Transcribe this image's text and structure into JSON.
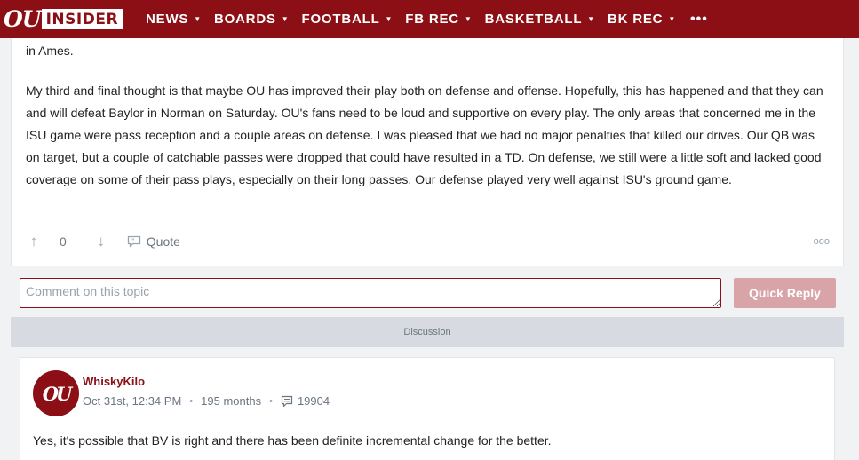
{
  "header": {
    "logo_ou": "OU",
    "logo_insider": "INSIDER",
    "nav": [
      {
        "label": "NEWS"
      },
      {
        "label": "BOARDS"
      },
      {
        "label": "FOOTBALL"
      },
      {
        "label": "FB REC"
      },
      {
        "label": "BASKETBALL"
      },
      {
        "label": "BK REC"
      }
    ],
    "more": "•••"
  },
  "post": {
    "paragraphs": [
      "in Ames.",
      "My third and final thought is that maybe OU has improved their play both on defense and offense. Hopefully, this has happened and that they can and will defeat Baylor in Norman on Saturday. OU's fans need to be loud and supportive on every play. The only areas that concerned me in the ISU game were pass reception and a couple areas on defense. I was pleased that we had no major penalties that killed our drives. Our QB was on target, but a couple of catchable passes were dropped that could have resulted in a TD. On defense, we still were a little soft and lacked good coverage on some of their pass plays, especially on their long passes. Our defense played very well against ISU's ground game."
    ],
    "upvote": "↑",
    "vote_count": "0",
    "downvote": "↓",
    "quote_label": "Quote",
    "more": "ooo"
  },
  "comment": {
    "placeholder": "Comment on this topic",
    "button": "Quick Reply"
  },
  "divider": {
    "label": "Discussion"
  },
  "reply": {
    "avatar_text": "OU",
    "author": "WhiskyKilo",
    "timestamp": "Oct 31st, 12:34 PM",
    "tenure": "195 months",
    "post_count": "19904",
    "body": "Yes, it's possible that BV is right and there has been definite incremental change for the better."
  },
  "colors": {
    "brand": "#8b0f14",
    "button_disabled": "#d9a4a7",
    "divider": "#d7dbe1",
    "muted": "#6b7580"
  }
}
